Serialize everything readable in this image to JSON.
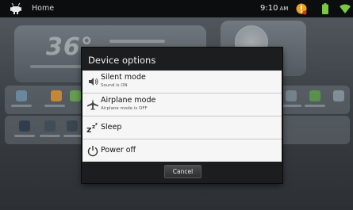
{
  "statusbar": {
    "home_label": "Home",
    "time": "9:10",
    "ampm": "AM",
    "icons": [
      "android-icon",
      "alert-icon",
      "battery-icon",
      "wifi-icon"
    ],
    "colors": {
      "alert": "#f0a020",
      "battery": "#7ac943",
      "wifi": "#7ac943"
    }
  },
  "home": {
    "temperature": "36°"
  },
  "dialog": {
    "title": "Device options",
    "options": [
      {
        "label": "Silent mode",
        "sub": "Sound is ON",
        "icon": "speaker-icon"
      },
      {
        "label": "Airplane mode",
        "sub": "Airplane mode is OFF",
        "icon": "airplane-icon"
      },
      {
        "label": "Sleep",
        "sub": "",
        "icon": "sleep-icon"
      },
      {
        "label": "Power off",
        "sub": "",
        "icon": "power-icon"
      }
    ],
    "cancel_label": "Cancel"
  }
}
